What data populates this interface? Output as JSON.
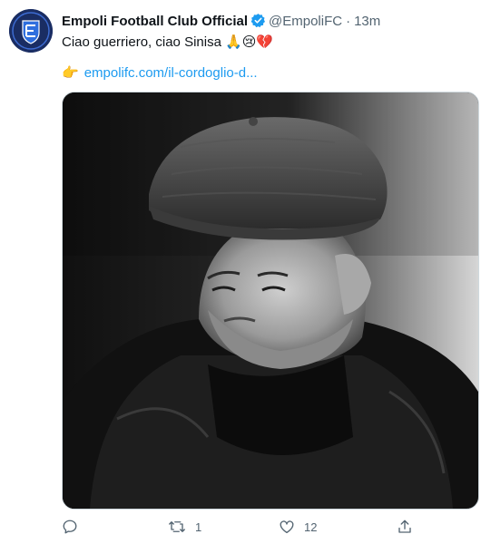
{
  "tweet": {
    "display_name": "Empoli Football Club Official",
    "handle": "@EmpoliFC",
    "separator": "·",
    "time": "13m",
    "text": "Ciao guerriero, ciao Sinisa",
    "text_emojis": "🙏😢💔",
    "link_prefix_emoji": "👉",
    "link_text": "empolifc.com/il-cordoglio-d..."
  },
  "actions": {
    "reply_count": "",
    "retweet_count": "1",
    "like_count": "12"
  },
  "colors": {
    "link": "#1d9bf0",
    "verified": "#1d9bf0",
    "muted": "#536471",
    "avatar_bg": "#1a2d63"
  },
  "icons": {
    "verified": "verified-badge-icon",
    "reply": "reply-icon",
    "retweet": "retweet-icon",
    "like": "heart-icon",
    "share": "share-icon"
  }
}
